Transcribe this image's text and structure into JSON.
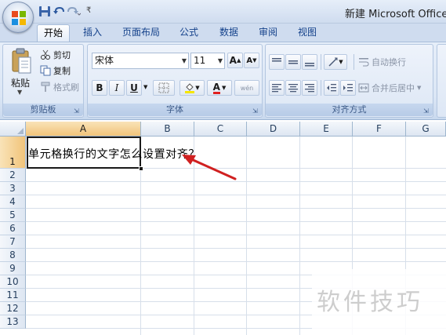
{
  "window": {
    "title": "新建 Microsoft Office Ex"
  },
  "quick_access": {
    "save_icon": "save-icon",
    "undo_icon": "undo-icon",
    "redo_icon": "redo-icon",
    "customize_label": "₹"
  },
  "tabs": [
    {
      "label": "开始",
      "active": true
    },
    {
      "label": "插入"
    },
    {
      "label": "页面布局"
    },
    {
      "label": "公式"
    },
    {
      "label": "数据"
    },
    {
      "label": "审阅"
    },
    {
      "label": "视图"
    }
  ],
  "clipboard": {
    "paste_label": "粘贴",
    "cut_label": "剪切",
    "copy_label": "复制",
    "format_painter_label": "格式刷",
    "group_label": "剪贴板"
  },
  "font": {
    "font_name": "宋体",
    "font_size": "11",
    "grow_label": "A",
    "shrink_label": "A",
    "bold": "B",
    "italic": "I",
    "underline": "U",
    "font_color_label": "A",
    "phonetic_label": "wén",
    "group_label": "字体",
    "font_color": "#e02020"
  },
  "alignment": {
    "wrap_text_label": "自动换行",
    "merge_center_label": "合并后居中",
    "group_label": "对齐方式"
  },
  "sheet": {
    "columns": [
      "A",
      "B",
      "C",
      "D",
      "E",
      "F",
      "G"
    ],
    "rows": [
      "1",
      "2",
      "3",
      "4",
      "5",
      "6",
      "7",
      "8",
      "9",
      "10",
      "11",
      "12",
      "13"
    ],
    "selected_column": "A",
    "selected_row": "1",
    "cell_a1_text": "单元格换行的文字怎么设置对齐？"
  },
  "watermark": "软件技巧",
  "colors": {
    "ribbon": "#dbe6f5",
    "accent": "#15428b",
    "arrow": "#d02020"
  }
}
